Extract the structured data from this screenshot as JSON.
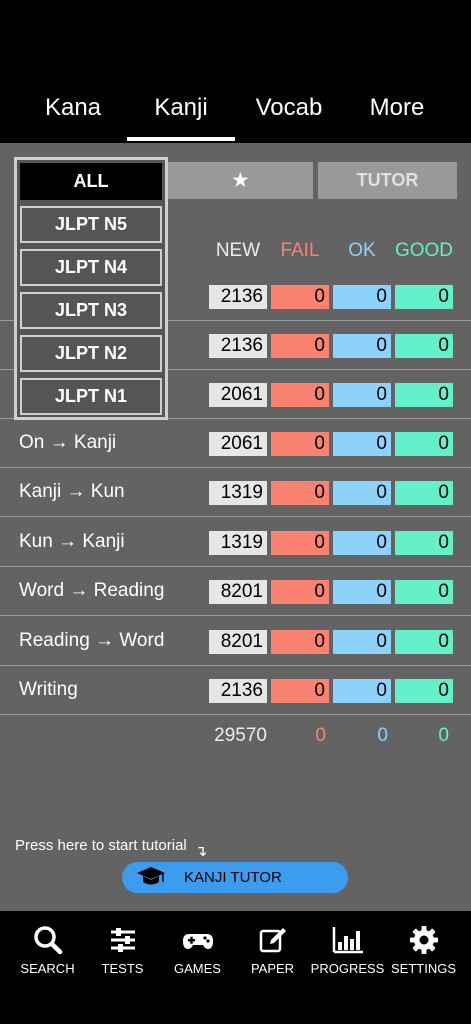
{
  "tabs": [
    {
      "label": "Kana"
    },
    {
      "label": "Kanji"
    },
    {
      "label": "Vocab"
    },
    {
      "label": "More"
    }
  ],
  "filters": {
    "star_glyph": "★",
    "tutor_label": "TUTOR"
  },
  "dropdown": {
    "items": [
      {
        "label": "ALL"
      },
      {
        "label": "JLPT N5"
      },
      {
        "label": "JLPT N4"
      },
      {
        "label": "JLPT N3"
      },
      {
        "label": "JLPT N2"
      },
      {
        "label": "JLPT N1"
      }
    ]
  },
  "columns": {
    "new": "NEW",
    "fail": "FAIL",
    "ok": "OK",
    "good": "GOOD"
  },
  "rows": [
    {
      "label": "",
      "new": "2136",
      "fail": "0",
      "ok": "0",
      "good": "0"
    },
    {
      "label": "",
      "new": "2136",
      "fail": "0",
      "ok": "0",
      "good": "0"
    },
    {
      "label": "",
      "new": "2061",
      "fail": "0",
      "ok": "0",
      "good": "0"
    },
    {
      "label": "On → Kanji",
      "new": "2061",
      "fail": "0",
      "ok": "0",
      "good": "0"
    },
    {
      "label": "Kanji → Kun",
      "new": "1319",
      "fail": "0",
      "ok": "0",
      "good": "0"
    },
    {
      "label": "Kun → Kanji",
      "new": "1319",
      "fail": "0",
      "ok": "0",
      "good": "0"
    },
    {
      "label": "Word → Reading",
      "new": "8201",
      "fail": "0",
      "ok": "0",
      "good": "0"
    },
    {
      "label": "Reading → Word",
      "new": "8201",
      "fail": "0",
      "ok": "0",
      "good": "0"
    },
    {
      "label": "Writing",
      "new": "2136",
      "fail": "0",
      "ok": "0",
      "good": "0"
    }
  ],
  "totals": {
    "new": "29570",
    "fail": "0",
    "ok": "0",
    "good": "0"
  },
  "tutorial": {
    "hint": "Press here to start tutorial",
    "hint_arrow": "↴",
    "button_label": "KANJI TUTOR"
  },
  "bottom_nav": [
    {
      "label": "SEARCH",
      "icon": "search-icon"
    },
    {
      "label": "TESTS",
      "icon": "sliders-icon"
    },
    {
      "label": "GAMES",
      "icon": "gamepad-icon"
    },
    {
      "label": "PAPER",
      "icon": "pencil-icon"
    },
    {
      "label": "PROGRESS",
      "icon": "bar-chart-icon"
    },
    {
      "label": "SETTINGS",
      "icon": "gear-icon"
    }
  ],
  "colors": {
    "fail": "#fa8270",
    "ok": "#8cd2fa",
    "good": "#64f0c8",
    "accent": "#3c9cf0"
  }
}
